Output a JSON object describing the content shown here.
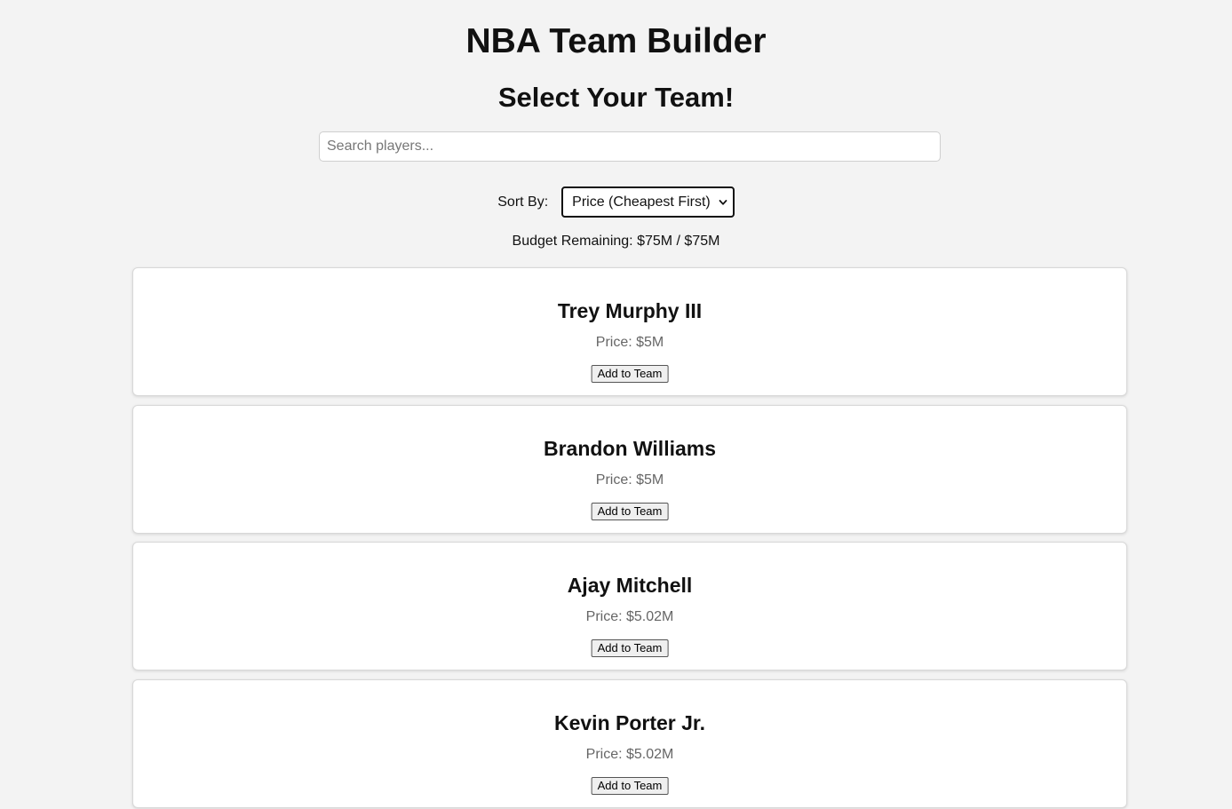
{
  "app": {
    "title": "NBA Team Builder",
    "subtitle": "Select Your Team!"
  },
  "search": {
    "placeholder": "Search players...",
    "value": ""
  },
  "sort": {
    "label": "Sort By:",
    "selected": "Price (Cheapest First)",
    "icon": "chevron-down-icon"
  },
  "budget": {
    "text": "Budget Remaining: $75M / $75M"
  },
  "players": [
    {
      "name": "Trey Murphy III",
      "price": "Price: $5M",
      "button": "Add to Team"
    },
    {
      "name": "Brandon Williams",
      "price": "Price: $5M",
      "button": "Add to Team"
    },
    {
      "name": "Ajay Mitchell",
      "price": "Price: $5.02M",
      "button": "Add to Team"
    },
    {
      "name": "Kevin Porter Jr.",
      "price": "Price: $5.02M",
      "button": "Add to Team"
    }
  ]
}
